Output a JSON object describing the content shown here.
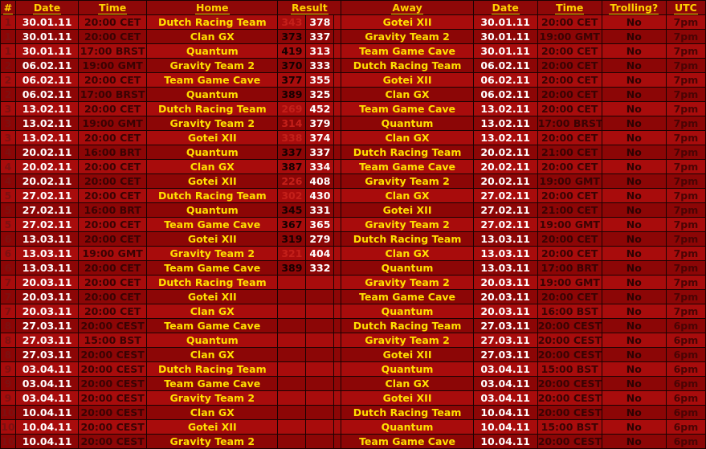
{
  "table": {
    "headers": {
      "index": "#",
      "date_home": "Date",
      "time_home": "Time",
      "home": "Home",
      "result": "Result",
      "away": "Away",
      "date_away": "Date",
      "time_away": "Time",
      "trolling": "Trolling?",
      "utc": "UTC"
    },
    "colors": {
      "header_text": "#ffd400",
      "row_light": "#a80c0c",
      "row_dark": "#8c0606",
      "team_text": "#ffe000",
      "date_text": "#ffffff",
      "win_score": "#ffffff",
      "lose_score": "#c4201a",
      "grid_line": "#1a0202"
    },
    "rows": [
      {
        "idx": "1",
        "date1": "30.01.11",
        "time1": "20:00 CET",
        "home": "Dutch Racing Team",
        "s1": "343",
        "s2": "378",
        "away": "Gotei XII",
        "date2": "30.01.11",
        "time2": "20:00 CET",
        "troll": "No",
        "utc": "7pm",
        "w": "away",
        "bg": "a"
      },
      {
        "idx": "1",
        "date1": "30.01.11",
        "time1": "20:00 CET",
        "home": "Clan GX",
        "s1": "373",
        "s2": "337",
        "away": "Gravity Team 2",
        "date2": "30.01.11",
        "time2": "19:00 GMT",
        "troll": "No",
        "utc": "7pm",
        "w": "home",
        "bg": "b"
      },
      {
        "idx": "1",
        "date1": "30.01.11",
        "time1": "17:00 BRST",
        "home": "Quantum",
        "s1": "419",
        "s2": "313",
        "away": "Team Game Cave",
        "date2": "30.01.11",
        "time2": "20:00 CET",
        "troll": "No",
        "utc": "7pm",
        "w": "home",
        "bg": "a"
      },
      {
        "idx": "2",
        "date1": "06.02.11",
        "time1": "19:00 GMT",
        "home": "Gravity Team 2",
        "s1": "370",
        "s2": "333",
        "away": "Dutch Racing Team",
        "date2": "06.02.11",
        "time2": "20:00 CET",
        "troll": "No",
        "utc": "7pm",
        "w": "home",
        "bg": "b"
      },
      {
        "idx": "2",
        "date1": "06.02.11",
        "time1": "20:00 CET",
        "home": "Team Game Cave",
        "s1": "377",
        "s2": "355",
        "away": "Gotei XII",
        "date2": "06.02.11",
        "time2": "20:00 CET",
        "troll": "No",
        "utc": "7pm",
        "w": "home",
        "bg": "a"
      },
      {
        "idx": "2",
        "date1": "06.02.11",
        "time1": "17:00 BRST",
        "home": "Quantum",
        "s1": "389",
        "s2": "325",
        "away": "Clan GX",
        "date2": "06.02.11",
        "time2": "20:00 CET",
        "troll": "No",
        "utc": "7pm",
        "w": "home",
        "bg": "b"
      },
      {
        "idx": "3",
        "date1": "13.02.11",
        "time1": "20:00 CET",
        "home": "Dutch Racing Team",
        "s1": "269",
        "s2": "452",
        "away": "Team Game Cave",
        "date2": "13.02.11",
        "time2": "20:00 CET",
        "troll": "No",
        "utc": "7pm",
        "w": "away",
        "bg": "a"
      },
      {
        "idx": "3",
        "date1": "13.02.11",
        "time1": "19:00 GMT",
        "home": "Gravity Team 2",
        "s1": "314",
        "s2": "379",
        "away": "Quantum",
        "date2": "13.02.11",
        "time2": "17:00 BRST",
        "troll": "No",
        "utc": "7pm",
        "w": "away",
        "bg": "b"
      },
      {
        "idx": "3",
        "date1": "13.02.11",
        "time1": "20:00 CET",
        "home": "Gotei XII",
        "s1": "338",
        "s2": "374",
        "away": "Clan GX",
        "date2": "13.02.11",
        "time2": "20:00 CET",
        "troll": "No",
        "utc": "7pm",
        "w": "away",
        "bg": "a"
      },
      {
        "idx": "4",
        "date1": "20.02.11",
        "time1": "16:00 BRT",
        "home": "Quantum",
        "s1": "337",
        "s2": "337",
        "away": "Dutch Racing Team",
        "date2": "20.02.11",
        "time2": "21:00 CET",
        "troll": "No",
        "utc": "7pm",
        "w": "tie",
        "bg": "b"
      },
      {
        "idx": "4",
        "date1": "20.02.11",
        "time1": "20:00 CET",
        "home": "Clan GX",
        "s1": "387",
        "s2": "334",
        "away": "Team Game Cave",
        "date2": "20.02.11",
        "time2": "20:00 CET",
        "troll": "No",
        "utc": "7pm",
        "w": "home",
        "bg": "a"
      },
      {
        "idx": "4",
        "date1": "20.02.11",
        "time1": "20:00 CET",
        "home": "Gotei XII",
        "s1": "226",
        "s2": "408",
        "away": "Gravity Team 2",
        "date2": "20.02.11",
        "time2": "19:00 GMT",
        "troll": "No",
        "utc": "7pm",
        "w": "away",
        "bg": "b"
      },
      {
        "idx": "5",
        "date1": "27.02.11",
        "time1": "20:00 CET",
        "home": "Dutch Racing Team",
        "s1": "302",
        "s2": "430",
        "away": "Clan GX",
        "date2": "27.02.11",
        "time2": "20:00 CET",
        "troll": "No",
        "utc": "7pm",
        "w": "away",
        "bg": "a"
      },
      {
        "idx": "5",
        "date1": "27.02.11",
        "time1": "16:00 BRT",
        "home": "Quantum",
        "s1": "345",
        "s2": "331",
        "away": "Gotei XII",
        "date2": "27.02.11",
        "time2": "21:00 CET",
        "troll": "No",
        "utc": "7pm",
        "w": "home",
        "bg": "b"
      },
      {
        "idx": "5",
        "date1": "27.02.11",
        "time1": "20:00 CET",
        "home": "Team Game Cave",
        "s1": "367",
        "s2": "365",
        "away": "Gravity Team 2",
        "date2": "27.02.11",
        "time2": "19:00 GMT",
        "troll": "No",
        "utc": "7pm",
        "w": "home",
        "bg": "a"
      },
      {
        "idx": "6",
        "date1": "13.03.11",
        "time1": "20:00 CET",
        "home": "Gotei XII",
        "s1": "319",
        "s2": "279",
        "away": "Dutch Racing Team",
        "date2": "13.03.11",
        "time2": "20:00 CET",
        "troll": "No",
        "utc": "7pm",
        "w": "home",
        "bg": "b"
      },
      {
        "idx": "6",
        "date1": "13.03.11",
        "time1": "19:00 GMT",
        "home": "Gravity Team 2",
        "s1": "321",
        "s2": "404",
        "away": "Clan GX",
        "date2": "13.03.11",
        "time2": "20:00 CET",
        "troll": "No",
        "utc": "7pm",
        "w": "away",
        "bg": "a"
      },
      {
        "idx": "6",
        "date1": "13.03.11",
        "time1": "20:00 CET",
        "home": "Team Game Cave",
        "s1": "389",
        "s2": "332",
        "away": "Quantum",
        "date2": "13.03.11",
        "time2": "17:00 BRT",
        "troll": "No",
        "utc": "7pm",
        "w": "home",
        "bg": "b"
      },
      {
        "idx": "7",
        "date1": "20.03.11",
        "time1": "20:00 CET",
        "home": "Dutch Racing Team",
        "s1": "",
        "s2": "",
        "away": "Gravity Team 2",
        "date2": "20.03.11",
        "time2": "19:00 GMT",
        "troll": "No",
        "utc": "7pm",
        "w": "none",
        "bg": "a"
      },
      {
        "idx": "7",
        "date1": "20.03.11",
        "time1": "20:00 CET",
        "home": "Gotei XII",
        "s1": "",
        "s2": "",
        "away": "Team Game Cave",
        "date2": "20.03.11",
        "time2": "20:00 CET",
        "troll": "No",
        "utc": "7pm",
        "w": "none",
        "bg": "b"
      },
      {
        "idx": "7",
        "date1": "20.03.11",
        "time1": "20:00 CET",
        "home": "Clan GX",
        "s1": "",
        "s2": "",
        "away": "Quantum",
        "date2": "20.03.11",
        "time2": "16:00 BST",
        "troll": "No",
        "utc": "7pm",
        "w": "none",
        "bg": "a"
      },
      {
        "idx": "8",
        "date1": "27.03.11",
        "time1": "20:00 CEST",
        "home": "Team Game Cave",
        "s1": "",
        "s2": "",
        "away": "Dutch Racing Team",
        "date2": "27.03.11",
        "time2": "20:00 CEST",
        "troll": "No",
        "utc": "6pm",
        "w": "none",
        "bg": "b"
      },
      {
        "idx": "8",
        "date1": "27.03.11",
        "time1": "15:00 BST",
        "home": "Quantum",
        "s1": "",
        "s2": "",
        "away": "Gravity Team 2",
        "date2": "27.03.11",
        "time2": "20:00 CEST",
        "troll": "No",
        "utc": "6pm",
        "w": "none",
        "bg": "a"
      },
      {
        "idx": "8",
        "date1": "27.03.11",
        "time1": "20:00 CEST",
        "home": "Clan GX",
        "s1": "",
        "s2": "",
        "away": "Gotei XII",
        "date2": "27.03.11",
        "time2": "20:00 CEST",
        "troll": "No",
        "utc": "6pm",
        "w": "none",
        "bg": "b"
      },
      {
        "idx": "9",
        "date1": "03.04.11",
        "time1": "20:00 CEST",
        "home": "Dutch Racing Team",
        "s1": "",
        "s2": "",
        "away": "Quantum",
        "date2": "03.04.11",
        "time2": "15:00 BST",
        "troll": "No",
        "utc": "6pm",
        "w": "none",
        "bg": "a"
      },
      {
        "idx": "9",
        "date1": "03.04.11",
        "time1": "20:00 CEST",
        "home": "Team Game Cave",
        "s1": "",
        "s2": "",
        "away": "Clan GX",
        "date2": "03.04.11",
        "time2": "20:00 CEST",
        "troll": "No",
        "utc": "6pm",
        "w": "none",
        "bg": "b"
      },
      {
        "idx": "9",
        "date1": "03.04.11",
        "time1": "20:00 CEST",
        "home": "Gravity Team 2",
        "s1": "",
        "s2": "",
        "away": "Gotei XII",
        "date2": "03.04.11",
        "time2": "20:00 CEST",
        "troll": "No",
        "utc": "6pm",
        "w": "none",
        "bg": "a"
      },
      {
        "idx": "10",
        "date1": "10.04.11",
        "time1": "20:00 CEST",
        "home": "Clan GX",
        "s1": "",
        "s2": "",
        "away": "Dutch Racing Team",
        "date2": "10.04.11",
        "time2": "20:00 CEST",
        "troll": "No",
        "utc": "6pm",
        "w": "none",
        "bg": "b"
      },
      {
        "idx": "10",
        "date1": "10.04.11",
        "time1": "20:00 CEST",
        "home": "Gotei XII",
        "s1": "",
        "s2": "",
        "away": "Quantum",
        "date2": "10.04.11",
        "time2": "15:00 BST",
        "troll": "No",
        "utc": "6pm",
        "w": "none",
        "bg": "a"
      },
      {
        "idx": "10",
        "date1": "10.04.11",
        "time1": "20:00 CEST",
        "home": "Gravity Team 2",
        "s1": "",
        "s2": "",
        "away": "Team Game Cave",
        "date2": "10.04.11",
        "time2": "20:00 CEST",
        "troll": "No",
        "utc": "6pm",
        "w": "none",
        "bg": "b"
      }
    ]
  }
}
